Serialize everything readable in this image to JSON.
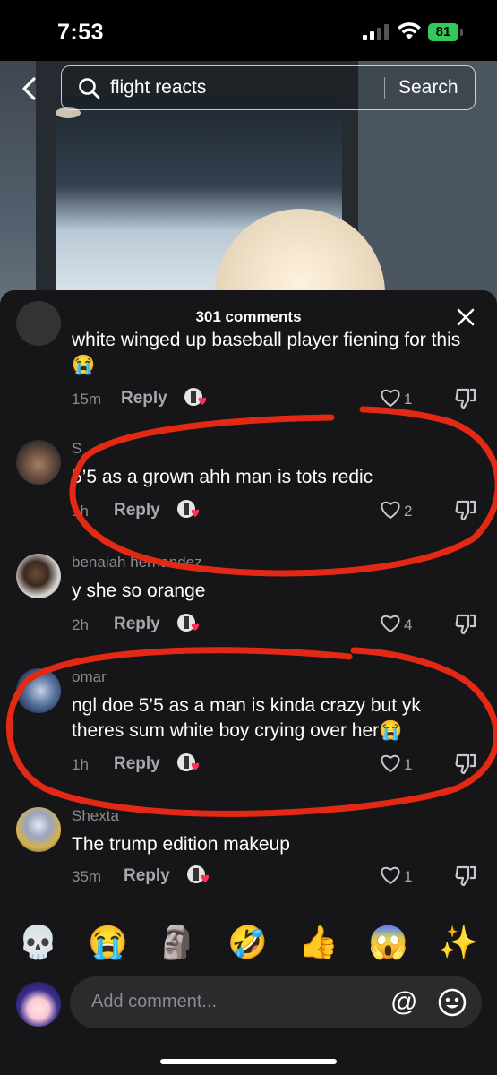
{
  "status_bar": {
    "time": "7:53",
    "battery": "81"
  },
  "search": {
    "query": "flight reacts",
    "button": "Search"
  },
  "sheet": {
    "title": "301 comments"
  },
  "comments": [
    {
      "text": "white winged up baseball player fiening for this 😭",
      "time": "15m",
      "reply": "Reply",
      "likes": "1"
    },
    {
      "username": "S",
      "text": "5’5 as a grown ahh man is tots redic",
      "time": "1h",
      "reply": "Reply",
      "likes": "2"
    },
    {
      "username": "benaiah hernandez",
      "text": "y she so orange",
      "time": "2h",
      "reply": "Reply",
      "likes": "4"
    },
    {
      "username": "omar",
      "text": "ngl doe 5’5 as a man is kinda crazy but yk theres sum white boy crying over her😭",
      "time": "1h",
      "reply": "Reply",
      "likes": "1"
    },
    {
      "username": "Shexta",
      "text": "The trump edition makeup",
      "time": "35m",
      "reply": "Reply",
      "likes": "1"
    }
  ],
  "quick_emojis": [
    "💀",
    "😭",
    "🗿",
    "🤣",
    "👍",
    "😱",
    "✨"
  ],
  "composer": {
    "placeholder": "Add comment...",
    "at": "@"
  },
  "colors": {
    "sheet_bg": "#161618",
    "annotation": "#e32914",
    "battery": "#35c759"
  }
}
